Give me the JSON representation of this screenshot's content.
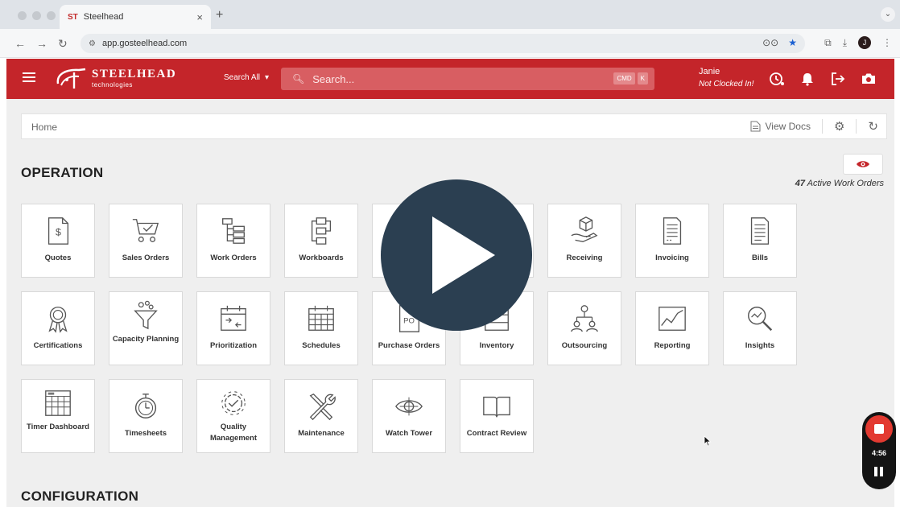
{
  "browser": {
    "tab_title": "Steelhead",
    "tab_close": "×",
    "new_tab": "+",
    "url": "app.gosteelhead.com",
    "profile_initial": "J"
  },
  "header": {
    "brand_name": "STEELHEAD",
    "brand_sub": "technologies",
    "search_scope": "Search All",
    "search_placeholder": "Search...",
    "kbd_keys": [
      "CMD",
      "K"
    ],
    "user_name": "Janie",
    "user_status": "Not Clocked In!",
    "brand_color": "#c4252a"
  },
  "breadcrumb": {
    "home": "Home",
    "view_docs": "View Docs"
  },
  "operation": {
    "title": "OPERATION",
    "active_count": "47",
    "active_label": "Active Work Orders",
    "tiles": [
      {
        "label": "Quotes",
        "icon": "dollar-document-icon"
      },
      {
        "label": "Sales Orders",
        "icon": "shopping-cart-icon"
      },
      {
        "label": "Work Orders",
        "icon": "hierarchy-list-icon"
      },
      {
        "label": "Workboards",
        "icon": "workflow-icon"
      },
      {
        "label": "",
        "icon": "hidden-tile"
      },
      {
        "label": "",
        "icon": "hidden-tile"
      },
      {
        "label": "Receiving",
        "icon": "box-hand-icon"
      },
      {
        "label": "Invoicing",
        "icon": "invoice-icon"
      },
      {
        "label": "Bills",
        "icon": "bill-icon"
      },
      {
        "label": "Certifications",
        "icon": "award-ribbon-icon"
      },
      {
        "label": "Capacity Planning",
        "icon": "funnel-icon"
      },
      {
        "label": "Prioritization",
        "icon": "calendar-arrows-icon"
      },
      {
        "label": "Schedules",
        "icon": "calendar-grid-icon"
      },
      {
        "label": "Purchase Orders",
        "icon": "po-document-icon"
      },
      {
        "label": "Inventory",
        "icon": "inventory-icon"
      },
      {
        "label": "Outsourcing",
        "icon": "org-chart-icon"
      },
      {
        "label": "Reporting",
        "icon": "line-chart-icon"
      },
      {
        "label": "Insights",
        "icon": "magnifier-icon"
      },
      {
        "label": "Timer Dashboard",
        "icon": "dashboard-grid-icon"
      },
      {
        "label": "Timesheets",
        "icon": "stopwatch-icon"
      },
      {
        "label": "Quality Management",
        "icon": "gear-check-icon"
      },
      {
        "label": "Maintenance",
        "icon": "wrench-screwdriver-icon"
      },
      {
        "label": "Watch Tower",
        "icon": "eye-target-icon"
      },
      {
        "label": "Contract Review",
        "icon": "open-book-icon"
      }
    ]
  },
  "configuration": {
    "title": "CONFIGURATION"
  },
  "recorder": {
    "time": "4:56"
  }
}
